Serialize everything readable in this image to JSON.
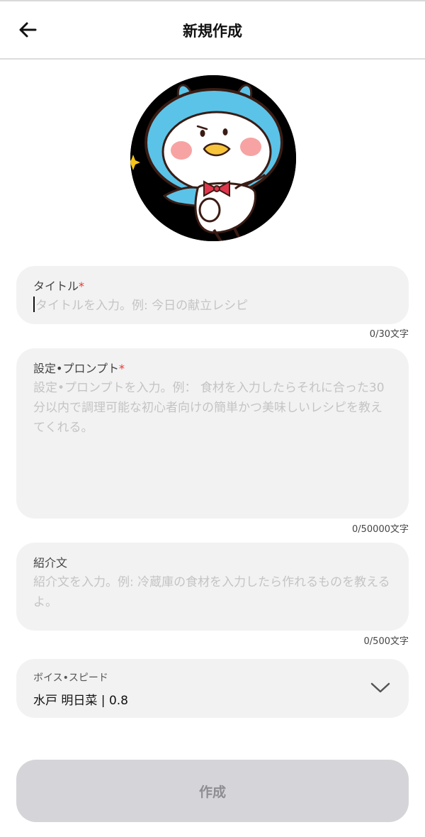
{
  "header": {
    "title": "新規作成"
  },
  "form": {
    "title_field": {
      "label": "タイトル",
      "required_mark": "*",
      "placeholder": "タイトルを入力。例: 今日の献立レシピ",
      "counter": "0/30文字"
    },
    "prompt_field": {
      "label": "設定•プロンプト",
      "required_mark": "*",
      "placeholder": "設定•プロンプトを入力。例： 食材を入力したらそれに合った30分以内で調理可能な初心者向けの簡単かつ美味しいレシピを教えてくれる。",
      "counter": "0/50000文字"
    },
    "intro_field": {
      "label": "紹介文",
      "placeholder": "紹介文を入力。例: 冷蔵庫の食材を入力したら作れるものを教えるよ。",
      "counter": "0/500文字"
    },
    "voice_select": {
      "label": "ボイス•スピード",
      "value": "水戸 明日菜 | 0.8"
    }
  },
  "submit_label": "作成",
  "colors": {
    "field_bg": "#f2f2f2",
    "required": "#e53935",
    "button_disabled": "#d5d5d9",
    "avatar_blue": "#5bc3e8"
  }
}
